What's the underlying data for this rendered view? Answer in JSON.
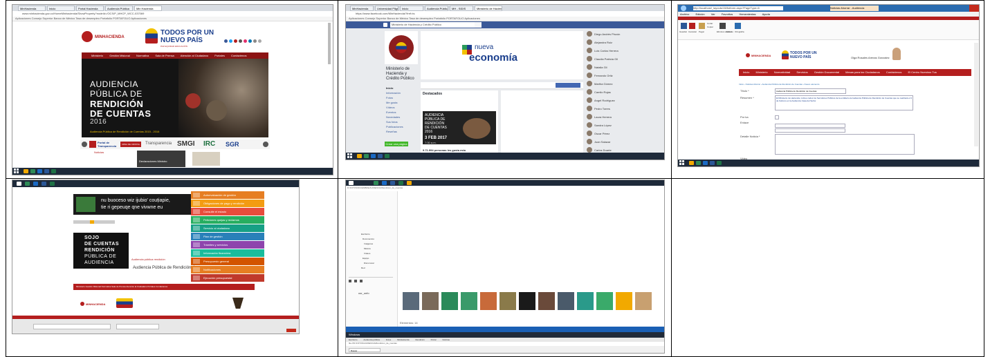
{
  "colors": {
    "red": "#b41e1e",
    "blue": "#1a3e8c",
    "yellow": "#f2c200",
    "facebook": "#3b5998",
    "taskbar": "#1e2a3a"
  },
  "s1": {
    "tabs": [
      "MinHacienda",
      "Inicio",
      "Portal Hacienda",
      "Audiencia Pública",
      "Min Hacienda"
    ],
    "address": "www.minhacienda.gov.co/HomeMinhacienda/ShowProperty?nodeId=/OCS/P_MHCP_WCC-037069",
    "bookmarks": "Aplicaciones  Consejo Superior  Banco de México  Tasa de desempleo  Portafolio  PORTAFOLIO  Aplicaciones",
    "minhacienda": "MINHACIENDA",
    "todos": "TODOS POR UN",
    "nuevo": "NUEVO PAÍS",
    "paz": "PAZ EQUIDAD EDUCACIÓN",
    "nav": [
      "Ministerio",
      "Gestión Misional",
      "Normativa",
      "Sala de Prensa",
      "Atención al Ciudadano",
      "Portales",
      "Contáctenos"
    ],
    "hero": [
      "AUDIENCIA",
      "PÚBLICA DE",
      "RENDICIÓN",
      "DE CUENTAS",
      "2016"
    ],
    "hero_caption": "Audiencia Pública de Rendición de Cuentas 2015 - 2016",
    "partners": [
      "Portal de Transparencia",
      "URNA DE CRISTAL",
      "Transparencia",
      "SMGI",
      "IRC",
      "SGR"
    ],
    "news1": "Noticias",
    "news2": "Declaraciones Ministro"
  },
  "s2": {
    "tabs": [
      "MinHacienda",
      "Universidad Pilgrims",
      "Inicio",
      "Audiencia Pública",
      "MH - SIDIS",
      "Ministerio de Hacienda"
    ],
    "address": "https://www.facebook.com/MinHacienda/?fref=ts",
    "bookmarks": "Aplicaciones  Consejo Superior  Banco de México  Tasa de desempleo  Portafolio  PORTAFOLIO  Aplicaciones",
    "search": "Ministerio de Hacienda y Crédito Público",
    "cover_n": "nueva",
    "cover_e": "economía",
    "page_name": "Ministerio de Hacienda y Crédito Público",
    "menu": [
      "Inicio",
      "Información",
      "Fotos",
      "Me gusta",
      "Vídeos",
      "Eventos",
      "Novedades",
      "Sus fotos",
      "Publicaciones",
      "Reseñas"
    ],
    "highlights": "Destacados",
    "post_title": "AUDIENCIA PÚBLICA DE RENDICIÓN DE CUENTAS 2016",
    "date": "3 FEB 2017",
    "time": "7:30 a.m.",
    "likes": "9.71.994 personas les gusta esto",
    "create": "Crear una página",
    "side_names": [
      "Diego Andrés Pinzón",
      "Alejandra Ruiz",
      "Luis Carlos Herrera",
      "Claudia Patricia Gil",
      "Natalia Gil",
      "Fernando Ortiz",
      "Martha Gómez",
      "Camilo Rojas",
      "Angel Rodríguez",
      "Pedro Torres",
      "Laura Herrera",
      "Sandra López",
      "Oscar Pérez",
      "Juan Salazar",
      "Carlos Duarte"
    ]
  },
  "s3": {
    "app_title": "Noticias Ahorrar - Audiencia",
    "address": "http://localhost/_layouts/15/listform.aspx?PageType=6",
    "menu": [
      "Archivo",
      "Edición",
      "Ver",
      "Favoritos",
      "Herramientas",
      "Ayuda"
    ],
    "ribbon": [
      "Guardar",
      "Cancelar",
      "Pegar",
      "Cortar",
      "Copiar",
      "Eliminar elemento",
      "Editar",
      "Ortografía"
    ],
    "minhacienda": "MINHACIENDA",
    "todos": "TODOS POR UN",
    "nuevo": "NUEVO PAÍS",
    "user": "Olga Rosales Arenas Gonzalez",
    "nav": [
      "Inicio",
      "Ministerio",
      "Normatividad",
      "Servicios",
      "Gestión Documental",
      "Mesas para los Ciudadanos",
      "Contáctenos",
      "El Centro Nuestros Tus"
    ],
    "breadcrumb": "Inicio  ›  Noticias Ahorrar  ›  Audiencia Pública de Rendición de Cuentas  ›  Nuevo elemento",
    "title_label": "Título *",
    "title_value": "Audiencia Pública de Rendición de Cuentas",
    "summary_label": "Resumen *",
    "summary_value": "El Ministerio de Hacienda, invita a todos los Servidores Públicos de la entidad a la Audiencia Pública de Rendición de Cuentas que se realizará el 3 de Febrero en la Audiencia Casa del Señor",
    "por_label": "Por ka",
    "enlace_label": "Enlace",
    "detalle_label": "Detalle Noticia *",
    "video_label": "Video"
  },
  "s4": {
    "mirror_slogan1": "nu buoceso wiz ijubio' couțiapie,",
    "mirror_slogan2": "tie ri gepeuqe qne vivwne eu",
    "hero": [
      "SOJO",
      "DE CUENTAS",
      "RENDICIÓN",
      "PÚBLICA DE",
      "AUDIENCIA"
    ],
    "caption": "Audiencia Pública de Rendición de",
    "bands": [
      "Autoevaluación de gestión",
      "Obligaciones de pago y rendición",
      "Consulte el estado",
      "Peticiones quejas y reclamos",
      "Servicio al ciudadano",
      "Plan de gestión",
      "Trámites y servicios",
      "Información financiera",
      "Presupuesto general",
      "Notificaciones",
      "Ejecución presupuestal"
    ],
    "bottom_text": "Audiencia pública rendición",
    "footer_nav": "Ministerio  Gestión Misional  Normativa  Sala de Prensa  Atención al Ciudadano  Portales  Contáctenos",
    "minhacienda": "MINHACIENDA"
  },
  "s5": {
    "path": "D:/FOTOS/DICIEMBRE/AUDIENCIA/Rendicion_de_cuentas",
    "user_label": "usr_unfo",
    "tree_items": [
      "Escritorio",
      "Documentos",
      "Imágenes",
      "Música",
      "Vídeos",
      "Equipo",
      "Disco local",
      "Red"
    ],
    "status": "Elementos: 14",
    "taskbar": "Windows",
    "search": "Buscar",
    "tabs": [
      "Escritorio",
      "Audiencia pública",
      "Fotos",
      "MinHacienda",
      "Rendición",
      "Portal",
      "Noticias"
    ],
    "url": "file:///D:/FOTOS/AUDIENCIA/Rendicion_de_cuentas"
  }
}
